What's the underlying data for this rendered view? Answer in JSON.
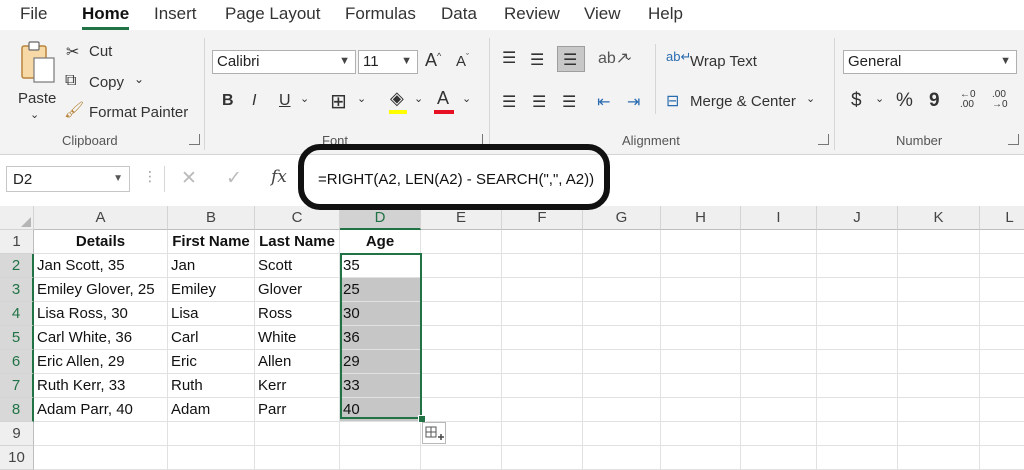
{
  "menu": {
    "tabs": [
      "File",
      "Home",
      "Insert",
      "Page Layout",
      "Formulas",
      "Data",
      "Review",
      "View",
      "Help"
    ],
    "active": "Home"
  },
  "clipboard": {
    "paste": "Paste",
    "cut": "Cut",
    "copy": "Copy",
    "format_painter": "Format Painter",
    "group_label": "Clipboard"
  },
  "font": {
    "name": "Calibri",
    "size": "11",
    "group_label": "Font",
    "bold": "B",
    "italic": "I",
    "underline": "U",
    "font_color": "#e81123",
    "highlight_color": "#ffff00"
  },
  "alignment": {
    "wrap_text": "Wrap Text",
    "merge_center": "Merge & Center",
    "group_label": "Alignment"
  },
  "number": {
    "format": "General",
    "group_label": "Number",
    "currency": "$",
    "percent": "%",
    "comma": "9",
    "inc_decimal": "←0 .00",
    "dec_decimal": ".00 →0"
  },
  "formula_bar": {
    "name_box": "D2",
    "formula": "=RIGHT(A2, LEN(A2) - SEARCH(\",\", A2))"
  },
  "sheet": {
    "columns": [
      "A",
      "B",
      "C",
      "D",
      "E",
      "F",
      "G",
      "H",
      "I",
      "J",
      "K",
      "L"
    ],
    "rows": [
      "1",
      "2",
      "3",
      "4",
      "5",
      "6",
      "7",
      "8",
      "9",
      "10"
    ],
    "headers": [
      "Details",
      "First Name",
      "Last Name",
      "Age"
    ],
    "data": [
      [
        "Jan Scott, 35",
        "Jan",
        "Scott",
        "35"
      ],
      [
        "Emiley Glover, 25",
        "Emiley",
        "Glover",
        "25"
      ],
      [
        "Lisa Ross, 30",
        "Lisa",
        "Ross",
        "30"
      ],
      [
        "Carl White, 36",
        "Carl",
        "White",
        "36"
      ],
      [
        "Eric Allen, 29",
        "Eric",
        "Allen",
        "29"
      ],
      [
        "Ruth Kerr, 33",
        "Ruth",
        "Kerr",
        "33"
      ],
      [
        "Adam Parr, 40",
        "Adam",
        "Parr",
        "40"
      ]
    ],
    "selected_column": "D",
    "accent": "#217346"
  }
}
